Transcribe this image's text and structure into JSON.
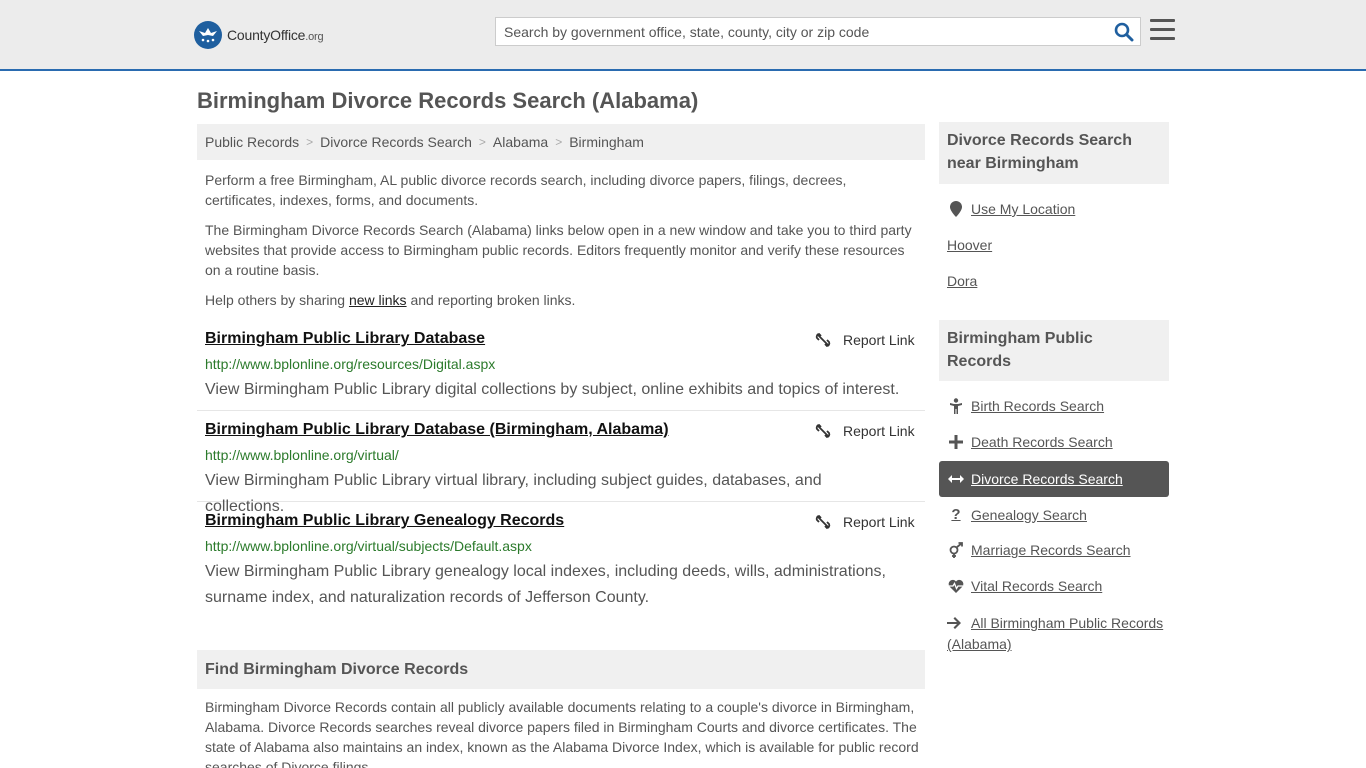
{
  "header": {
    "logo_brand": "CountyOffice",
    "logo_tld": ".org",
    "search_placeholder": "Search by government office, state, county, city or zip code"
  },
  "page_title": "Birmingham Divorce Records Search (Alabama)",
  "breadcrumb": [
    "Public Records",
    "Divorce Records Search",
    "Alabama",
    "Birmingham"
  ],
  "intro": {
    "p1": "Perform a free Birmingham, AL public divorce records search, including divorce papers, filings, decrees, certificates, indexes, forms, and documents.",
    "p2": "The Birmingham Divorce Records Search (Alabama) links below open in a new window and take you to third party websites that provide access to Birmingham public records. Editors frequently monitor and verify these resources on a routine basis.",
    "p3_before": "Help others by sharing ",
    "p3_link": "new links",
    "p3_after": " and reporting broken links."
  },
  "results": [
    {
      "title": "Birmingham Public Library Database",
      "url": "http://www.bplonline.org/resources/Digital.aspx",
      "description": "View Birmingham Public Library digital collections by subject, online exhibits and topics of interest.",
      "report_label": "Report Link"
    },
    {
      "title": "Birmingham Public Library Database (Birmingham, Alabama)",
      "url": "http://www.bplonline.org/virtual/",
      "description": "View Birmingham Public Library virtual library, including subject guides, databases, and collections.",
      "report_label": "Report Link"
    },
    {
      "title": "Birmingham Public Library Genealogy Records",
      "url": "http://www.bplonline.org/virtual/subjects/Default.aspx",
      "description": "View Birmingham Public Library genealogy local indexes, including deeds, wills, administrations, surname index, and naturalization records of Jefferson County.",
      "report_label": "Report Link"
    }
  ],
  "find_section": {
    "heading": "Find Birmingham Divorce Records",
    "body": "Birmingham Divorce Records contain all publicly available documents relating to a couple's divorce in Birmingham, Alabama. Divorce Records searches reveal divorce papers filed in Birmingham Courts and divorce certificates. The state of Alabama also maintains an index, known as the Alabama Divorce Index, which is available for public record searches of Divorce filings."
  },
  "sidebar": {
    "nearby_heading": "Divorce Records Search near Birmingham",
    "use_location": "Use My Location",
    "nearby": [
      "Hoover",
      "Dora"
    ],
    "public_heading": "Birmingham Public Records",
    "links": [
      {
        "label": "Birth Records Search",
        "icon": "child-icon"
      },
      {
        "label": "Death Records Search",
        "icon": "cross-icon"
      },
      {
        "label": "Divorce Records Search",
        "icon": "arrows-icon",
        "active": true
      },
      {
        "label": "Genealogy Search",
        "icon": "question-icon"
      },
      {
        "label": "Marriage Records Search",
        "icon": "venus-mars-icon"
      },
      {
        "label": "Vital Records Search",
        "icon": "heartbeat-icon"
      }
    ],
    "all_link": "All Birmingham Public Records (Alabama)"
  },
  "colors": {
    "accent": "#2a6bb0",
    "link_green": "#2b7a2b",
    "active_bg": "#555555"
  }
}
